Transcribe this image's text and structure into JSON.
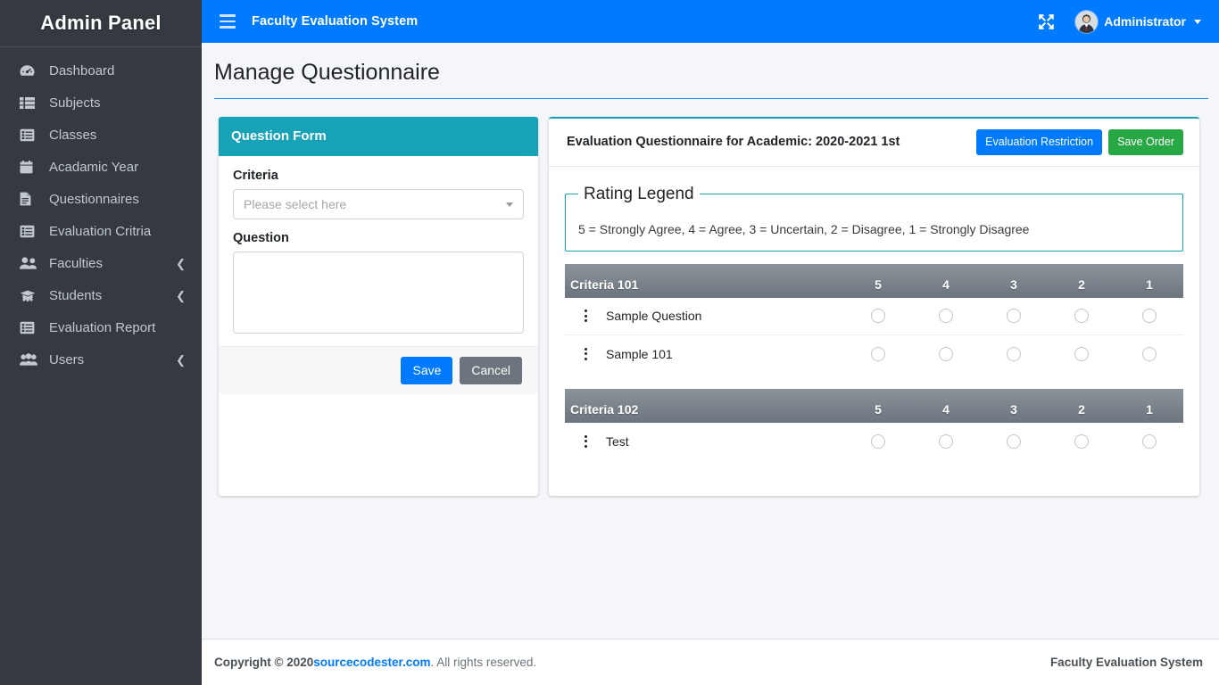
{
  "sidebar": {
    "brand": "Admin Panel",
    "items": [
      {
        "label": "Dashboard",
        "icon": "tachometer-icon",
        "expandable": false
      },
      {
        "label": "Subjects",
        "icon": "th-list-icon",
        "expandable": false
      },
      {
        "label": "Classes",
        "icon": "list-alt-icon",
        "expandable": false
      },
      {
        "label": "Acadamic Year",
        "icon": "calendar-icon",
        "expandable": false
      },
      {
        "label": "Questionnaires",
        "icon": "file-document-icon",
        "expandable": false
      },
      {
        "label": "Evaluation Critria",
        "icon": "list-alt-icon",
        "expandable": false
      },
      {
        "label": "Faculties",
        "icon": "users-icon",
        "expandable": true
      },
      {
        "label": "Students",
        "icon": "student-group-icon",
        "expandable": true
      },
      {
        "label": "Evaluation Report",
        "icon": "list-alt-icon",
        "expandable": false
      },
      {
        "label": "Users",
        "icon": "users-group-icon",
        "expandable": true
      }
    ],
    "expand_arrow": "❮"
  },
  "header": {
    "menu_icon": "hamburger-icon",
    "title": "Faculty Evaluation System",
    "fullscreen_icon": "fullscreen-icon",
    "user_name": "Administrator",
    "avatar_icon": "user-avatar"
  },
  "page": {
    "title": "Manage Questionnaire"
  },
  "question_form": {
    "header": "Question Form",
    "criteria_label": "Criteria",
    "criteria_placeholder": "Please select here",
    "criteria_value": "",
    "question_label": "Question",
    "question_value": "",
    "question_placeholder": "",
    "save_label": "Save",
    "cancel_label": "Cancel"
  },
  "questionnaire": {
    "title": "Evaluation Questionnaire for Academic: 2020-2021 1st",
    "restriction_button": "Evaluation Restriction",
    "save_order_button": "Save Order",
    "legend_title": "Rating Legend",
    "legend_text": "5 = Strongly Agree, 4 = Agree, 3 = Uncertain, 2 = Disagree, 1 = Strongly Disagree",
    "rating_columns": [
      "5",
      "4",
      "3",
      "2",
      "1"
    ],
    "criteria": [
      {
        "name": "Criteria 101",
        "questions": [
          {
            "text": "Sample Question"
          },
          {
            "text": "Sample 101"
          }
        ]
      },
      {
        "name": "Criteria 102",
        "questions": [
          {
            "text": "Test"
          }
        ]
      }
    ]
  },
  "footer": {
    "copyright_prefix": "Copyright © 2020 ",
    "link_text": "sourcecodester.com",
    "copyright_suffix": ". All rights reserved.",
    "right_text": "Faculty Evaluation System"
  },
  "colors": {
    "header_blue": "#007bff",
    "sidebar_dark": "#343a40",
    "teal": "#17a2b8",
    "green": "#28a745",
    "gray": "#6c757d",
    "content_bg": "#f4f6f9"
  }
}
